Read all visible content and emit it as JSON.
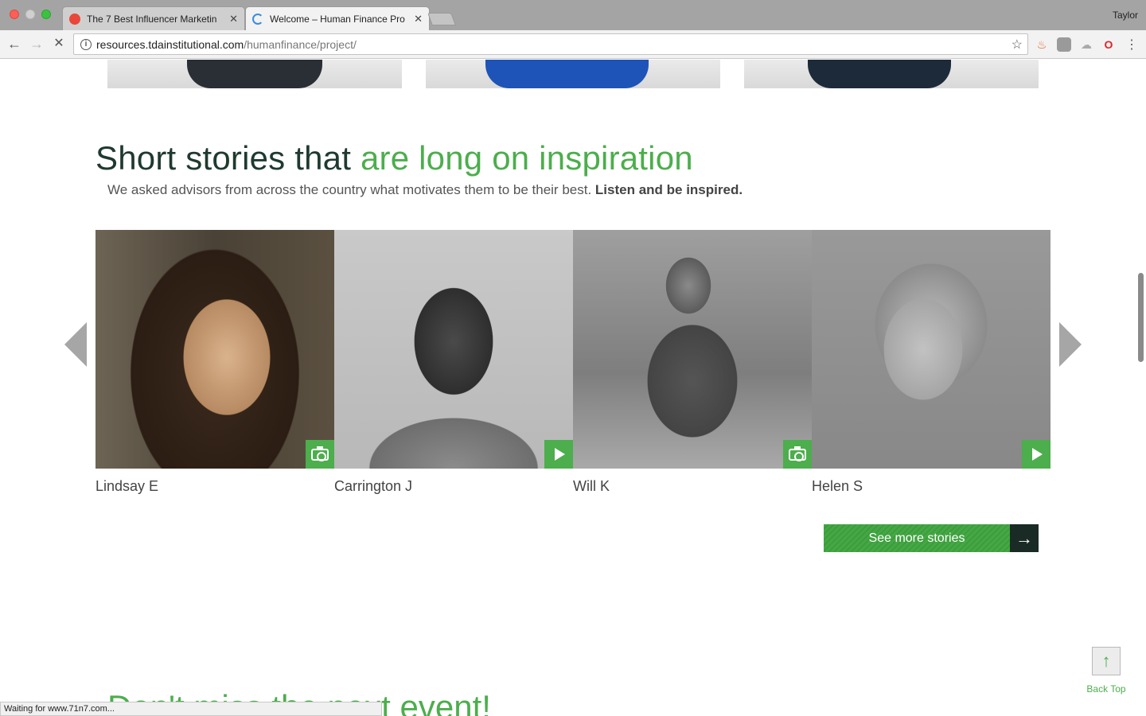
{
  "browser": {
    "tabs": [
      {
        "title": "The 7 Best Influencer Marketin",
        "icon": "red-circle-favicon"
      },
      {
        "title": "Welcome – Human Finance Pro",
        "icon": "loading-spinner-icon"
      }
    ],
    "profile": "Taylor",
    "url_host": "resources.tdainstitutional.com",
    "url_path": "/humanfinance/project/",
    "status": "Waiting for www.71n7.com..."
  },
  "section": {
    "headline_dark": "Short stories that ",
    "headline_green": "are long on inspiration",
    "subline": "We asked advisors from across the country what motivates them to be their best. ",
    "subline_bold": "Listen and be inspired."
  },
  "stories": [
    {
      "name": "Lindsay E",
      "media": "camera-icon"
    },
    {
      "name": "Carrington J",
      "media": "play-icon"
    },
    {
      "name": "Will K",
      "media": "camera-icon"
    },
    {
      "name": "Helen S",
      "media": "play-icon"
    }
  ],
  "more_button": {
    "label": "See more stories",
    "icon": "arrow-right-icon"
  },
  "event_title": "Don't miss the next event!",
  "back_top": {
    "label": "Back Top",
    "icon": "arrow-up-icon"
  },
  "colors": {
    "accent": "#4cae4c",
    "dark": "#1f3a2f"
  }
}
